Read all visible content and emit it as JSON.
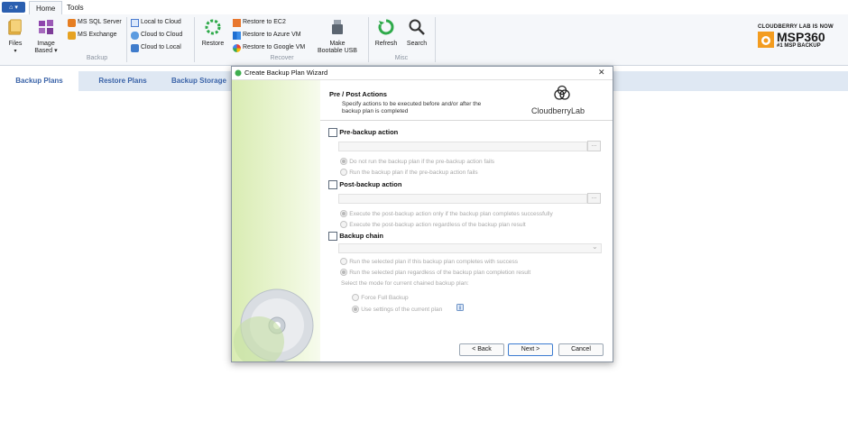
{
  "ribbon": {
    "app_button": "⌂ ▾",
    "tabs": [
      "Home",
      "Tools"
    ],
    "files": "Files",
    "files_arrow": "▾",
    "image_based_line1": "Image",
    "image_based_line2": "Based ▾",
    "ms_sql": "MS SQL Server",
    "ms_exchange": "MS Exchange",
    "local_to_cloud": "Local to Cloud",
    "cloud_to_cloud": "Cloud to Cloud",
    "cloud_to_local": "Cloud to Local",
    "group_backup": "Backup",
    "restore": "Restore",
    "restore_ec2": "Restore to EC2",
    "restore_azure": "Restore to Azure VM",
    "restore_google": "Restore to Google VM",
    "make_usb_line1": "Make",
    "make_usb_line2": "Bootable USB",
    "group_recover": "Recover",
    "refresh": "Refresh",
    "search": "Search",
    "group_misc": "Misc"
  },
  "brand": {
    "top": "CLOUDBERRY LAB IS NOW",
    "name": "MSP360",
    "tagline": "#1 MSP BACKUP",
    "accent": "#f39c1f"
  },
  "nav": {
    "tabs": [
      "Backup Plans",
      "Restore Plans",
      "Backup Storage"
    ]
  },
  "dialog": {
    "title": "Create Backup Plan Wizard",
    "close": "✕",
    "heading": "Pre / Post Actions",
    "description_line1": "Specify actions to be executed before and/or after the",
    "description_line2": "backup plan is completed",
    "logo_text": "CloudberryLab",
    "pre": {
      "label": "Pre-backup action",
      "browse": "...",
      "opt1": "Do not run the backup plan if the pre-backup action fails",
      "opt2": "Run the backup plan if the pre-backup action fails"
    },
    "post": {
      "label": "Post-backup action",
      "browse": "...",
      "opt1": "Execute the post-backup action only if the backup plan completes successfully",
      "opt2": "Execute the post-backup action regardless of the backup plan result"
    },
    "chain": {
      "label": "Backup chain",
      "dropdown_arrow": "⌄",
      "opt1": "Run the selected plan if this backup plan completes with success",
      "opt2": "Run the selected plan regardless of the backup plan completion result",
      "mode_label": "Select the mode for current chained backup plan:",
      "mode1": "Force Full Backup",
      "mode2": "Use settings of the current plan"
    },
    "buttons": {
      "back": "< Back",
      "next": "Next >",
      "cancel": "Cancel"
    }
  }
}
